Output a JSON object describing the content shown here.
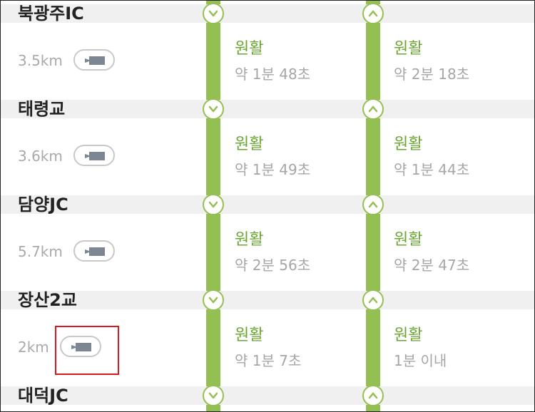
{
  "colors": {
    "track": "#94bf52",
    "status": "#6aa631",
    "highlight": "#d9191c"
  },
  "stations": [
    {
      "name": "북광주IC"
    },
    {
      "name": "태령교"
    },
    {
      "name": "담양JC"
    },
    {
      "name": "장산2교"
    },
    {
      "name": "대덕JC"
    }
  ],
  "segments": [
    {
      "distance": "3.5km",
      "cctv_icon": "cctv-camera-icon",
      "down": {
        "status": "원활",
        "time": "약 1분 48초"
      },
      "up": {
        "status": "원활",
        "time": "약 2분 18초"
      }
    },
    {
      "distance": "3.6km",
      "cctv_icon": "cctv-camera-icon",
      "down": {
        "status": "원활",
        "time": "약 1분 49초"
      },
      "up": {
        "status": "원활",
        "time": "약 1분 44초"
      }
    },
    {
      "distance": "5.7km",
      "cctv_icon": "cctv-camera-icon",
      "down": {
        "status": "원활",
        "time": "약 2분 56초"
      },
      "up": {
        "status": "원활",
        "time": "약 2분 47초"
      }
    },
    {
      "distance": "2km",
      "cctv_icon": "cctv-camera-icon",
      "down": {
        "status": "원활",
        "time": "약 1분 7초"
      },
      "up": {
        "status": "원활",
        "time": "1분 이내"
      }
    }
  ],
  "direction_icons": {
    "down": "chevron-down-icon",
    "up": "chevron-up-icon"
  }
}
